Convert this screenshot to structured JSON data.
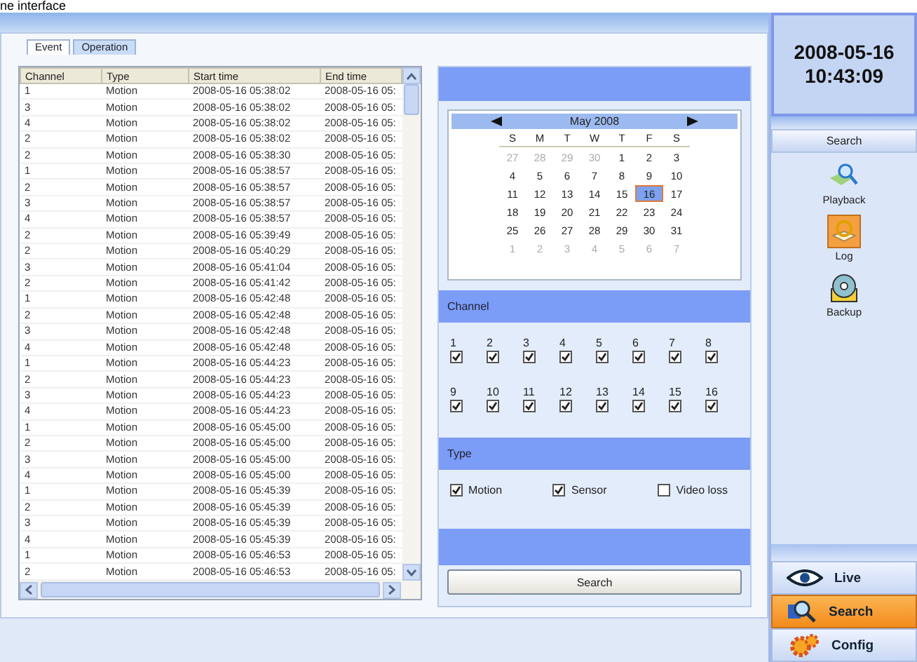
{
  "caption": "ne interface",
  "tabs": [
    {
      "label": "Event",
      "selected": true
    },
    {
      "label": "Operation",
      "selected": false
    }
  ],
  "table": {
    "columns": [
      "Channel",
      "Type",
      "Start time",
      "End time"
    ],
    "rows": [
      [
        "1",
        "Motion",
        "2008-05-16 05:38:02",
        "2008-05-16 05:"
      ],
      [
        "3",
        "Motion",
        "2008-05-16 05:38:02",
        "2008-05-16 05:"
      ],
      [
        "4",
        "Motion",
        "2008-05-16 05:38:02",
        "2008-05-16 05:"
      ],
      [
        "2",
        "Motion",
        "2008-05-16 05:38:02",
        "2008-05-16 05:"
      ],
      [
        "2",
        "Motion",
        "2008-05-16 05:38:30",
        "2008-05-16 05:"
      ],
      [
        "1",
        "Motion",
        "2008-05-16 05:38:57",
        "2008-05-16 05:"
      ],
      [
        "2",
        "Motion",
        "2008-05-16 05:38:57",
        "2008-05-16 05:"
      ],
      [
        "3",
        "Motion",
        "2008-05-16 05:38:57",
        "2008-05-16 05:"
      ],
      [
        "4",
        "Motion",
        "2008-05-16 05:38:57",
        "2008-05-16 05:"
      ],
      [
        "2",
        "Motion",
        "2008-05-16 05:39:49",
        "2008-05-16 05:"
      ],
      [
        "2",
        "Motion",
        "2008-05-16 05:40:29",
        "2008-05-16 05:"
      ],
      [
        "3",
        "Motion",
        "2008-05-16 05:41:04",
        "2008-05-16 05:"
      ],
      [
        "2",
        "Motion",
        "2008-05-16 05:41:42",
        "2008-05-16 05:"
      ],
      [
        "1",
        "Motion",
        "2008-05-16 05:42:48",
        "2008-05-16 05:"
      ],
      [
        "2",
        "Motion",
        "2008-05-16 05:42:48",
        "2008-05-16 05:"
      ],
      [
        "3",
        "Motion",
        "2008-05-16 05:42:48",
        "2008-05-16 05:"
      ],
      [
        "4",
        "Motion",
        "2008-05-16 05:42:48",
        "2008-05-16 05:"
      ],
      [
        "1",
        "Motion",
        "2008-05-16 05:44:23",
        "2008-05-16 05:"
      ],
      [
        "2",
        "Motion",
        "2008-05-16 05:44:23",
        "2008-05-16 05:"
      ],
      [
        "3",
        "Motion",
        "2008-05-16 05:44:23",
        "2008-05-16 05:"
      ],
      [
        "4",
        "Motion",
        "2008-05-16 05:44:23",
        "2008-05-16 05:"
      ],
      [
        "1",
        "Motion",
        "2008-05-16 05:45:00",
        "2008-05-16 05:"
      ],
      [
        "2",
        "Motion",
        "2008-05-16 05:45:00",
        "2008-05-16 05:"
      ],
      [
        "3",
        "Motion",
        "2008-05-16 05:45:00",
        "2008-05-16 05:"
      ],
      [
        "4",
        "Motion",
        "2008-05-16 05:45:00",
        "2008-05-16 05:"
      ],
      [
        "1",
        "Motion",
        "2008-05-16 05:45:39",
        "2008-05-16 05:"
      ],
      [
        "2",
        "Motion",
        "2008-05-16 05:45:39",
        "2008-05-16 05:"
      ],
      [
        "3",
        "Motion",
        "2008-05-16 05:45:39",
        "2008-05-16 05:"
      ],
      [
        "4",
        "Motion",
        "2008-05-16 05:45:39",
        "2008-05-16 05:"
      ],
      [
        "1",
        "Motion",
        "2008-05-16 05:46:53",
        "2008-05-16 05:"
      ],
      [
        "2",
        "Motion",
        "2008-05-16 05:46:53",
        "2008-05-16 05:"
      ]
    ]
  },
  "calendar": {
    "month": "May 2008",
    "weekdays": [
      "S",
      "M",
      "T",
      "W",
      "T",
      "F",
      "S"
    ],
    "days": [
      {
        "label": "27",
        "other": true,
        "selected": false
      },
      {
        "label": "28",
        "other": true,
        "selected": false
      },
      {
        "label": "29",
        "other": true,
        "selected": false
      },
      {
        "label": "30",
        "other": true,
        "selected": false
      },
      {
        "label": "1",
        "other": false,
        "selected": false
      },
      {
        "label": "2",
        "other": false,
        "selected": false
      },
      {
        "label": "3",
        "other": false,
        "selected": false
      },
      {
        "label": "4",
        "other": false,
        "selected": false
      },
      {
        "label": "5",
        "other": false,
        "selected": false
      },
      {
        "label": "6",
        "other": false,
        "selected": false
      },
      {
        "label": "7",
        "other": false,
        "selected": false
      },
      {
        "label": "8",
        "other": false,
        "selected": false
      },
      {
        "label": "9",
        "other": false,
        "selected": false
      },
      {
        "label": "10",
        "other": false,
        "selected": false
      },
      {
        "label": "11",
        "other": false,
        "selected": false
      },
      {
        "label": "12",
        "other": false,
        "selected": false
      },
      {
        "label": "13",
        "other": false,
        "selected": false
      },
      {
        "label": "14",
        "other": false,
        "selected": false
      },
      {
        "label": "15",
        "other": false,
        "selected": false
      },
      {
        "label": "16",
        "other": false,
        "selected": true
      },
      {
        "label": "17",
        "other": false,
        "selected": false
      },
      {
        "label": "18",
        "other": false,
        "selected": false
      },
      {
        "label": "19",
        "other": false,
        "selected": false
      },
      {
        "label": "20",
        "other": false,
        "selected": false
      },
      {
        "label": "21",
        "other": false,
        "selected": false
      },
      {
        "label": "22",
        "other": false,
        "selected": false
      },
      {
        "label": "23",
        "other": false,
        "selected": false
      },
      {
        "label": "24",
        "other": false,
        "selected": false
      },
      {
        "label": "25",
        "other": false,
        "selected": false
      },
      {
        "label": "26",
        "other": false,
        "selected": false
      },
      {
        "label": "27",
        "other": false,
        "selected": false
      },
      {
        "label": "28",
        "other": false,
        "selected": false
      },
      {
        "label": "29",
        "other": false,
        "selected": false
      },
      {
        "label": "30",
        "other": false,
        "selected": false
      },
      {
        "label": "31",
        "other": false,
        "selected": false
      },
      {
        "label": "1",
        "other": true,
        "selected": false
      },
      {
        "label": "2",
        "other": true,
        "selected": false
      },
      {
        "label": "3",
        "other": true,
        "selected": false
      },
      {
        "label": "4",
        "other": true,
        "selected": false
      },
      {
        "label": "5",
        "other": true,
        "selected": false
      },
      {
        "label": "6",
        "other": true,
        "selected": false
      },
      {
        "label": "7",
        "other": true,
        "selected": false
      }
    ]
  },
  "channel_section": {
    "title": "Channel",
    "channels": [
      {
        "label": "1",
        "checked": true
      },
      {
        "label": "2",
        "checked": true
      },
      {
        "label": "3",
        "checked": true
      },
      {
        "label": "4",
        "checked": true
      },
      {
        "label": "5",
        "checked": true
      },
      {
        "label": "6",
        "checked": true
      },
      {
        "label": "7",
        "checked": true
      },
      {
        "label": "8",
        "checked": true
      },
      {
        "label": "9",
        "checked": true
      },
      {
        "label": "10",
        "checked": true
      },
      {
        "label": "11",
        "checked": true
      },
      {
        "label": "12",
        "checked": true
      },
      {
        "label": "13",
        "checked": true
      },
      {
        "label": "14",
        "checked": true
      },
      {
        "label": "15",
        "checked": true
      },
      {
        "label": "16",
        "checked": true
      }
    ]
  },
  "type_section": {
    "title": "Type",
    "types": [
      {
        "label": "Motion",
        "checked": true
      },
      {
        "label": "Sensor",
        "checked": true
      },
      {
        "label": "Video loss",
        "checked": false
      }
    ]
  },
  "search_button": "Search",
  "clock": {
    "date": "2008-05-16",
    "time": "10:43:09"
  },
  "sidebar": {
    "header": "Search",
    "items": [
      {
        "label": "Playback",
        "kind": "playback",
        "selected": false
      },
      {
        "label": "Log",
        "kind": "log",
        "selected": true
      },
      {
        "label": "Backup",
        "kind": "backup",
        "selected": false
      }
    ]
  },
  "nav": [
    {
      "label": "Live",
      "kind": "live",
      "selected": false
    },
    {
      "label": "Search",
      "kind": "search",
      "selected": true
    },
    {
      "label": "Config",
      "kind": "config",
      "selected": false
    }
  ]
}
